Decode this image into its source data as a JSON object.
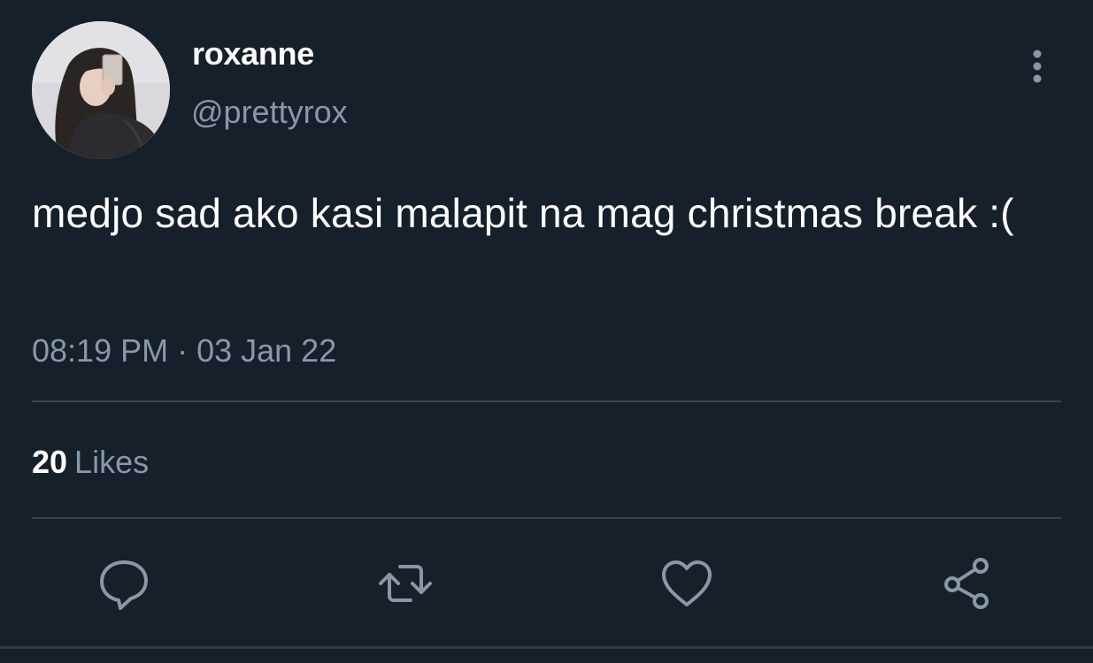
{
  "tweet": {
    "display_name": "roxanne",
    "handle": "@prettyrox",
    "text": "medjo sad ako kasi malapit na mag christmas break :(",
    "time": "08:19 PM",
    "separator": "·",
    "date": "03 Jan 22",
    "likes_count": "20",
    "likes_label": "Likes"
  },
  "icons": {
    "avatar": "profile-photo",
    "more": "vertical-ellipsis-icon",
    "reply": "speech-bubble-icon",
    "retweet": "retweet-arrows-icon",
    "like": "heart-outline-icon",
    "share": "share-nodes-icon"
  },
  "colors": {
    "background": "#15202b",
    "primary_text": "#ffffff",
    "secondary_text": "#8899a6",
    "divider": "#38444d"
  }
}
